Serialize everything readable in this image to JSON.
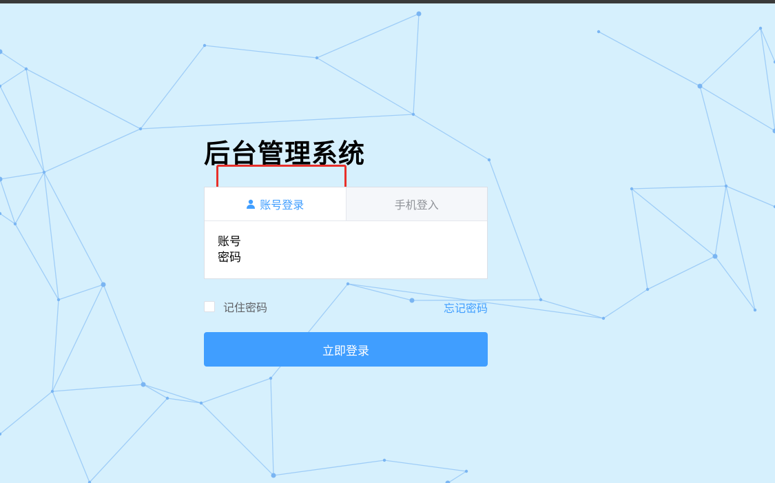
{
  "page": {
    "title": "后台管理系统"
  },
  "tabs": [
    {
      "label": "账号登录",
      "icon": "user-icon",
      "active": true
    },
    {
      "label": "手机登入",
      "active": false
    }
  ],
  "form": {
    "account_label": "账号",
    "password_label": "密码"
  },
  "options": {
    "remember_label": "记住密码",
    "remember_checked": false,
    "forgot_label": "忘记密码"
  },
  "login_button": {
    "label": "立即登录"
  },
  "colors": {
    "background": "#d6f0fd",
    "accent": "#409eff",
    "highlight_border": "#e8302a"
  }
}
